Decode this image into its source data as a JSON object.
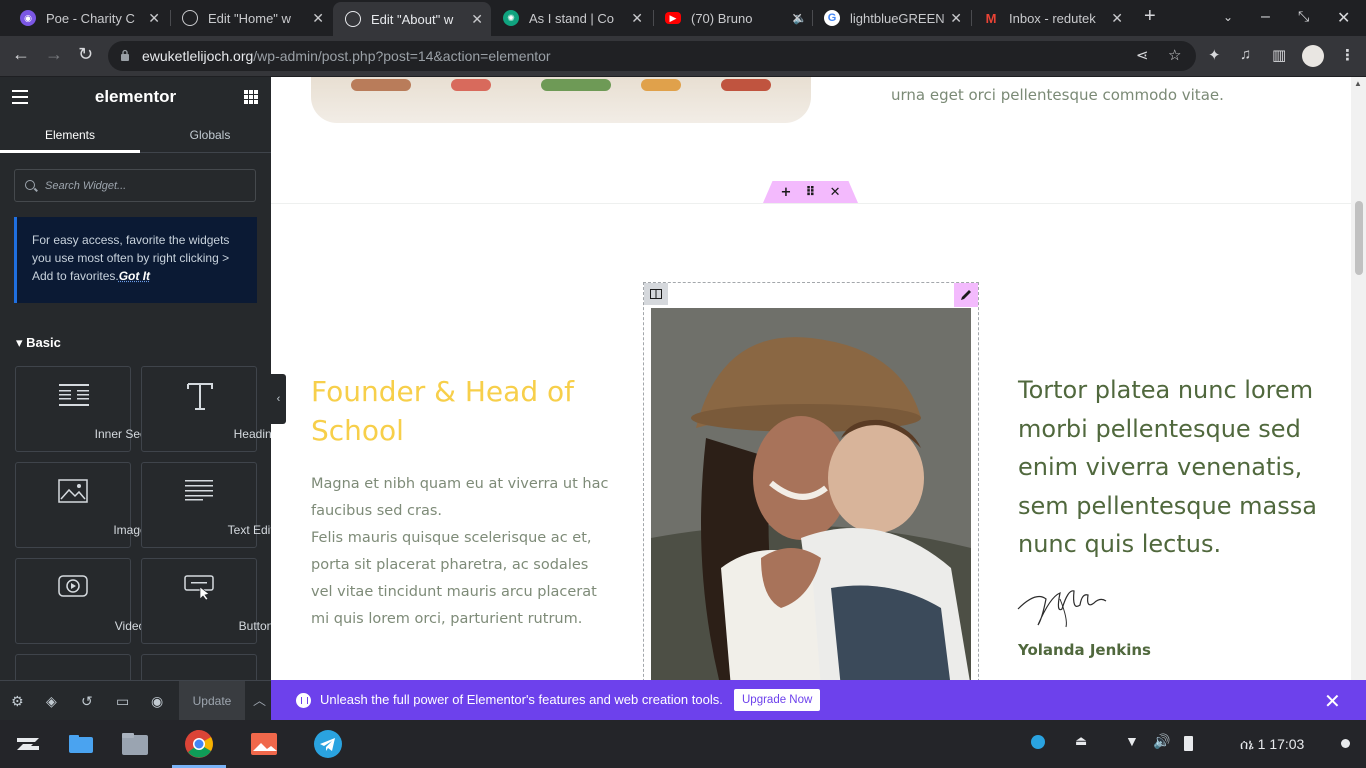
{
  "browser": {
    "tabs": [
      {
        "title": "Poe - Charity C",
        "icon": "poe-icon",
        "color": "#7b57e4"
      },
      {
        "title": "Edit \"Home\" w",
        "icon": "globe-icon",
        "color": "#5f6368"
      },
      {
        "title": "Edit \"About\" w",
        "icon": "globe-icon",
        "color": "#5f6368",
        "active": true
      },
      {
        "title": "As I stand | Co",
        "icon": "chatgpt-icon",
        "color": "#10a37f"
      },
      {
        "title": "(70) Bruno",
        "icon": "youtube-icon",
        "color": "#ff0000"
      },
      {
        "title": "lightblueGREEN",
        "icon": "google-icon",
        "color": "#4285f4"
      },
      {
        "title": "Inbox - redutek",
        "icon": "gmail-icon",
        "color": "#ea4335"
      }
    ],
    "url": {
      "host": "ewuketlelijoch.org",
      "path": "/wp-admin/post.php?post=14&action=elementor"
    }
  },
  "panel": {
    "brand": "elementor",
    "tabs": [
      "Elements",
      "Globals"
    ],
    "search_placeholder": "Search Widget...",
    "tip_text": "For easy access, favorite the widgets you use most often by right clicking > Add to favorites.",
    "tip_link": "Got It",
    "category": "Basic",
    "widgets": [
      {
        "label": "Inner Section",
        "icon": "inner-section-icon"
      },
      {
        "label": "Heading",
        "icon": "heading-icon"
      },
      {
        "label": "Image",
        "icon": "image-icon"
      },
      {
        "label": "Text Editor",
        "icon": "text-editor-icon"
      },
      {
        "label": "Video",
        "icon": "video-icon"
      },
      {
        "label": "Button",
        "icon": "button-icon"
      }
    ],
    "footer": {
      "update_label": "Update"
    }
  },
  "canvas": {
    "top_text": "urna eget orci pellentesque commodo vitae.",
    "founder_title": "Founder & Head of School",
    "founder_desc_1": "Magna et nibh quam eu at viverra ut hac faucibus sed cras.",
    "founder_desc_2": "Felis mauris quisque scelerisque ac et, porta sit placerat pharetra, ac sodales vel vitae tincidunt mauris arcu placerat mi quis lorem orci, parturient rutrum.",
    "quote": "Tortor platea nunc lorem morbi pellentesque sed enim viverra venenatis, sem pellentesque massa nunc quis lectus.",
    "signature_name": "Yolanda Jenkins"
  },
  "promo": {
    "message": "Unleash the full power of Elementor's features and web creation tools.",
    "button": "Upgrade Now"
  },
  "taskbar": {
    "clock": "ሰኔ 1  17:03"
  },
  "colors": {
    "accent_yellow": "#f7cf4a",
    "text_green": "#50683d",
    "promo_purple": "#6d41ec",
    "handle_pink": "#f3bafd"
  }
}
